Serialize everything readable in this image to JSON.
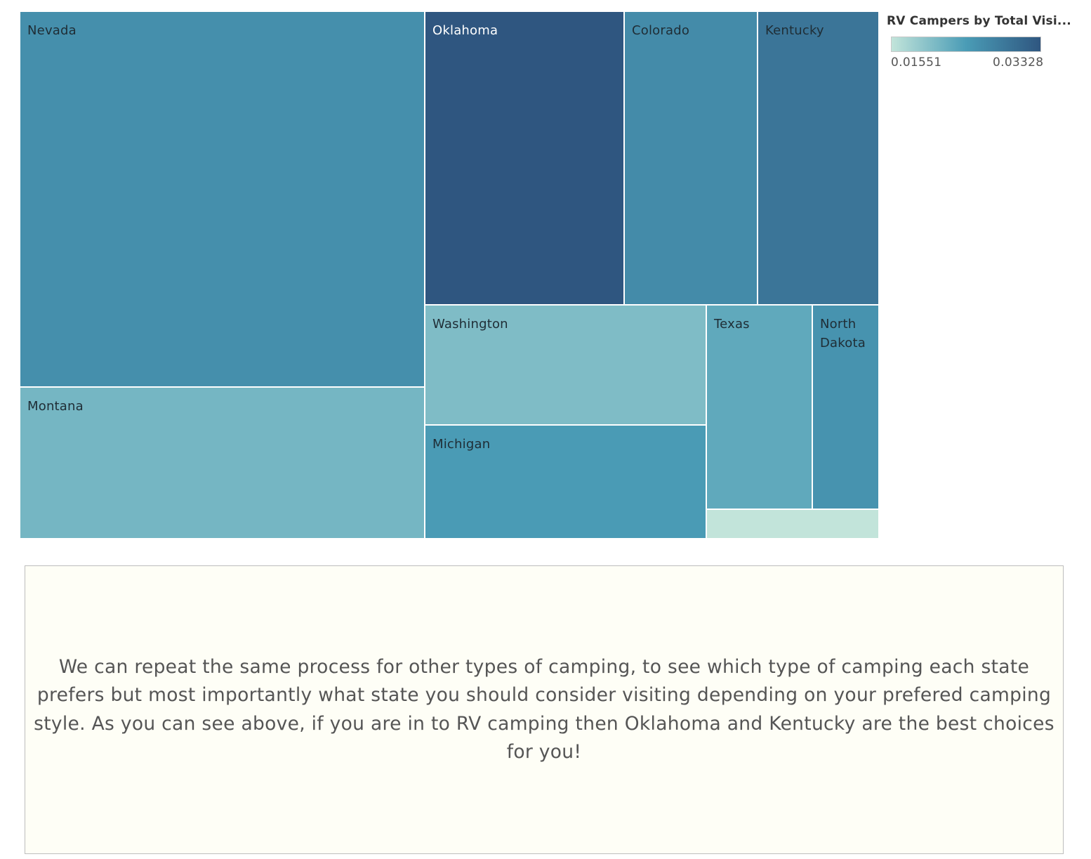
{
  "chart_data": {
    "type": "treemap",
    "legend": {
      "title": "RV Campers by Total Visi...",
      "min_label": "0.01551",
      "max_label": "0.03328",
      "min_value": 0.01551,
      "max_value": 0.03328,
      "color_low": "#c2e4da",
      "color_mid": "#4a9cb6",
      "color_high": "#2f5680",
      "placement": "top-right"
    },
    "tiles": [
      {
        "label": "Nevada",
        "color_value": 0.026
      },
      {
        "label": "Montana",
        "color_value": 0.0212
      },
      {
        "label": "Oklahoma",
        "color_value": 0.0333
      },
      {
        "label": "Colorado",
        "color_value": 0.0265
      },
      {
        "label": "Kentucky",
        "color_value": 0.0293
      },
      {
        "label": "Washington",
        "color_value": 0.0205
      },
      {
        "label": "Michigan",
        "color_value": 0.0245
      },
      {
        "label": "Texas",
        "color_value": 0.0228
      },
      {
        "label": "North Dakota",
        "color_value": 0.0255
      },
      {
        "label": "",
        "color_value": 0.0155
      }
    ]
  },
  "note": {
    "text": "We can repeat the same process for other types of camping, to see which type of camping each state prefers but most importantly what state you should consider visiting depending on your prefered camping style. As you can see above, if you are in to RV camping then Oklahoma and Kentucky are the best choices for you!"
  }
}
